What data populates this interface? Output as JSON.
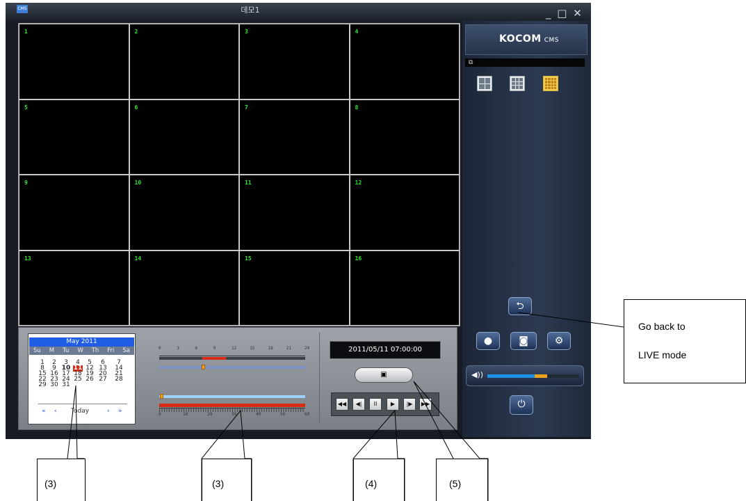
{
  "window": {
    "title": "데모1",
    "app_icon": "CMS",
    "controls": "_ □ ✕"
  },
  "video_grid": {
    "channels": [
      "1",
      "2",
      "3",
      "4",
      "5",
      "6",
      "7",
      "8",
      "9",
      "10",
      "11",
      "12",
      "13",
      "14",
      "15",
      "16"
    ]
  },
  "side_panel": {
    "brand": "KOCOM",
    "brand_sub": "CMS",
    "bar_icon": "restore-icon",
    "layouts": [
      "2x2",
      "3x3",
      "4x4"
    ],
    "selected_layout": "4x4",
    "volume_level": 0.65
  },
  "calendar": {
    "month": "May 2011",
    "weekdays": [
      "Su",
      "M",
      "Tu",
      "W",
      "Th",
      "Fri",
      "Sa"
    ],
    "weeks": [
      [
        "1",
        "2",
        "3",
        "4",
        "5",
        "6",
        "7"
      ],
      [
        "8",
        "9",
        "10",
        "11",
        "12",
        "13",
        "14"
      ],
      [
        "15",
        "16",
        "17",
        "18",
        "19",
        "20",
        "21"
      ],
      [
        "22",
        "23",
        "24",
        "25",
        "26",
        "27",
        "28"
      ],
      [
        "29",
        "30",
        "31",
        "",
        "",
        "",
        ""
      ]
    ],
    "today_date": "10",
    "selected_date": "11",
    "today_label": "Today"
  },
  "timeline": {
    "hour_ticks": [
      "0",
      "3",
      "6",
      "9",
      "12",
      "15",
      "18",
      "21",
      "24"
    ],
    "minute_ticks": [
      "0",
      "10",
      "20",
      "30",
      "40",
      "50",
      "60"
    ]
  },
  "playback": {
    "datetime": "2011/05/11   07:00:00",
    "buttons": [
      "rewind",
      "step-back",
      "pause",
      "play",
      "step-forward",
      "fast-forward"
    ]
  },
  "annotations": {
    "go_back": {
      "line1": "Go  back  to",
      "line2": "LIVE mode"
    },
    "labels": [
      "(3)",
      "(3)",
      "(4)",
      "(5)"
    ]
  },
  "colors": {
    "channel_number": "#2fe82f",
    "calendar_header": "#1f5de6",
    "selected_day": "#d82a16",
    "volume": "#1e90e8",
    "accent": "#f0a21c"
  }
}
